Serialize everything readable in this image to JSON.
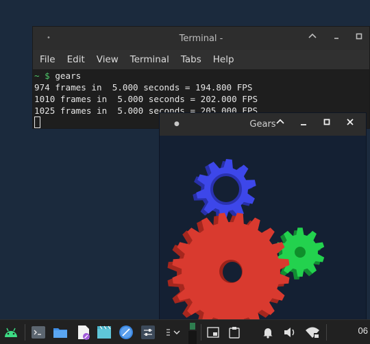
{
  "terminal": {
    "title": "Terminal -",
    "menu": [
      "File",
      "Edit",
      "View",
      "Terminal",
      "Tabs",
      "Help"
    ],
    "prompt": "~ $",
    "command": "gears",
    "lines": [
      "974 frames in  5.000 seconds = 194.800 FPS",
      "1010 frames in  5.000 seconds = 202.000 FPS",
      "1025 frames in  5.000 seconds = 205.000 FPS"
    ]
  },
  "gears_window": {
    "title": "Gears"
  },
  "taskbar": {
    "clock": "06",
    "icons": [
      "android-icon",
      "terminal-icon",
      "folder-icon",
      "document-editor-icon",
      "media-icon",
      "browser-icon",
      "settings-icon",
      "app-switcher-icon",
      "window-icon",
      "clipboard-icon",
      "notification-icon",
      "volume-icon",
      "wifi-icon"
    ]
  },
  "colors": {
    "desktop": "#1b2a3d",
    "gear_red": "#d63a2f",
    "gear_green": "#1fcf4a",
    "gear_blue": "#3a45e6"
  }
}
